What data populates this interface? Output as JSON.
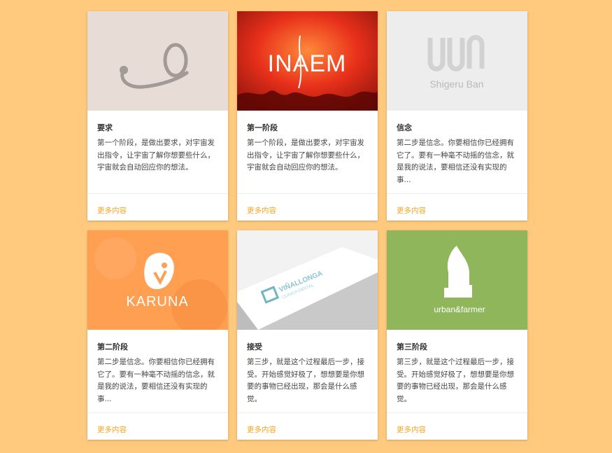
{
  "theme": {
    "background": "#FFCA7E",
    "link_color": "#F5A623"
  },
  "cards": [
    {
      "logo": "ring-swirl-logo",
      "title": "要求",
      "description": "第一个阶段，是做出要求，对宇宙发出指令，让宇宙了解你想要些什么，宇宙就会自动回应你的想法。",
      "more": "更多内容"
    },
    {
      "logo_text": "INAEM",
      "title": "第一阶段",
      "description": "第一个阶段，是做出要求，对宇宙发出指令，让宇宙了解你想要些什么，宇宙就会自动回应你的想法。",
      "more": "更多内容"
    },
    {
      "logo_text": "Shigeru Ban",
      "title": "信念",
      "description": "第二步是信念。你要相信你已经拥有它了。要有一种毫不动摇的信念，就是我的说法，要相信还没有实现的事...",
      "more": "更多内容"
    },
    {
      "logo_text": "KARUNA",
      "title": "第二阶段",
      "description": "第二步是信念。你要相信你已经拥有它了。要有一种毫不动摇的信念，就是我的说法，要相信还没有实现的事...",
      "more": "更多内容"
    },
    {
      "logo_text": "VIÑALLONGA",
      "logo_subtext": "CLÍNICA DENTAL",
      "title": "接受",
      "description": "第三步，就是这个过程最后一步，接受。开始感觉好极了，想想要是你想要的事物已经出现，那会是什么感觉。",
      "more": "更多内容"
    },
    {
      "logo_text": "urban&farmer",
      "title": "第三阶段",
      "description": "第三步，就是这个过程最后一步，接受。开始感觉好极了，想想要是你想要的事物已经出现，那会是什么感觉。",
      "more": "更多内容"
    }
  ]
}
